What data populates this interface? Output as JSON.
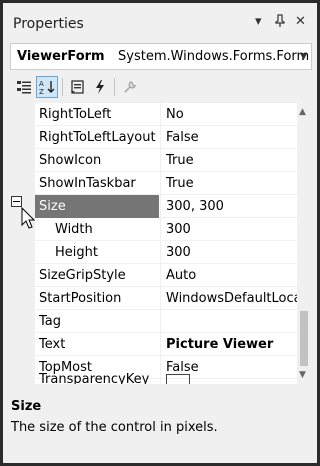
{
  "window": {
    "title": "Properties",
    "dropdown_glyph": "▾",
    "pin_glyph": "ᵖ",
    "close_glyph": "✕"
  },
  "object_selector": {
    "name": "ViewerForm",
    "type": "System.Windows.Forms.Form",
    "arrow": "▾"
  },
  "toolbar": {
    "categorized_icon": "categorized-icon",
    "alphabetical_icon": "alphabetical-icon",
    "properties_icon": "properties-icon",
    "events_icon": "events-icon",
    "property_pages_icon": "property-pages-icon"
  },
  "properties": [
    {
      "name": "RightToLeft",
      "value": "No"
    },
    {
      "name": "RightToLeftLayout",
      "value": "False"
    },
    {
      "name": "ShowIcon",
      "value": "True"
    },
    {
      "name": "ShowInTaskbar",
      "value": "True"
    },
    {
      "name": "Size",
      "value": "300, 300"
    },
    {
      "name": "Width",
      "value": "300"
    },
    {
      "name": "Height",
      "value": "300"
    },
    {
      "name": "SizeGripStyle",
      "value": "Auto"
    },
    {
      "name": "StartPosition",
      "value": "WindowsDefaultLocation"
    },
    {
      "name": "Tag",
      "value": ""
    },
    {
      "name": "Text",
      "value": "Picture Viewer"
    },
    {
      "name": "TopMost",
      "value": "False"
    },
    {
      "name": "TransparencyKey",
      "value": ""
    }
  ],
  "description": {
    "title": "Size",
    "text": "The size of the control in pixels."
  },
  "colors": {
    "selected_row": "#757575",
    "gutter": "#f0f0f0",
    "border": "#2b2b2b"
  }
}
